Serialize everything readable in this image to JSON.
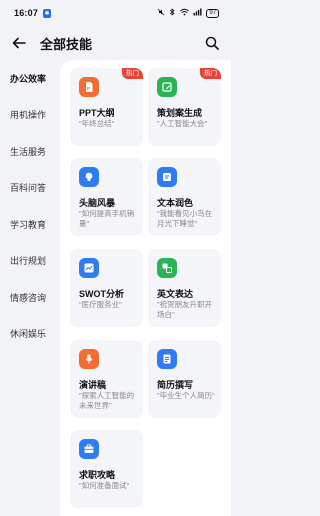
{
  "status_bar": {
    "time": "16:07",
    "battery": "97"
  },
  "header": {
    "title": "全部技能"
  },
  "sidebar": {
    "items": [
      {
        "label": "办公效率"
      },
      {
        "label": "用机操作"
      },
      {
        "label": "生活服务"
      },
      {
        "label": "百科问答"
      },
      {
        "label": "学习教育"
      },
      {
        "label": "出行规划"
      },
      {
        "label": "情感咨询"
      },
      {
        "label": "休闲娱乐"
      }
    ]
  },
  "cards": [
    {
      "title": "PPT大纲",
      "desc": "\"年终总结\"",
      "badge": "热门",
      "icon": "ppt-document-icon",
      "color": "#f26d2f"
    },
    {
      "title": "策划案生成",
      "desc": "\"人工智能大会\"",
      "badge": "热门",
      "icon": "edit-pencil-icon",
      "color": "#2ab455"
    },
    {
      "title": "头脑风暴",
      "desc": "\"如何提高手机销量\"",
      "badge": "",
      "icon": "lightbulb-icon",
      "color": "#2f7bf2"
    },
    {
      "title": "文本润色",
      "desc": "\"我能看见小鸟在月光下睡觉\"",
      "badge": "",
      "icon": "text-polish-icon",
      "color": "#2f7bf2"
    },
    {
      "title": "SWOT分析",
      "desc": "\"医疗服务业\"",
      "badge": "",
      "icon": "chart-analysis-icon",
      "color": "#2f7bf2"
    },
    {
      "title": "英文表达",
      "desc": "\"祝贺朋友升职开场白\"",
      "badge": "",
      "icon": "translate-icon",
      "color": "#2ab455"
    },
    {
      "title": "演讲稿",
      "desc": "\"探索人工智能的未来世界\"",
      "badge": "",
      "icon": "microphone-icon",
      "color": "#f26d2f"
    },
    {
      "title": "简历撰写",
      "desc": "\"毕业生个人简历\"",
      "badge": "",
      "icon": "resume-icon",
      "color": "#2f7bf2"
    },
    {
      "title": "求职攻略",
      "desc": "\"如何准备面试\"",
      "badge": "",
      "icon": "briefcase-icon",
      "color": "#2f7bf2"
    }
  ]
}
